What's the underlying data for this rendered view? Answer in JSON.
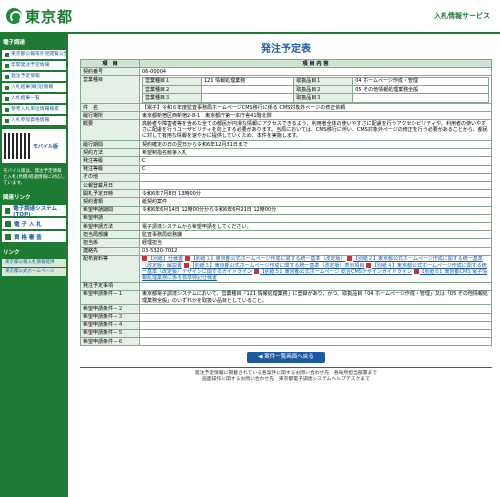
{
  "header": {
    "logo_text": "東京都",
    "right_link": "入札情報サービス"
  },
  "sidebar": {
    "section1": "電子調達",
    "items1": [
      "東京都公報等外見閲覧公告",
      "年間発注予定情報",
      "発注予定情報",
      "入札結果(概況)情報",
      "入札結果一覧",
      "参考入札単位情報検索",
      "入札参加資格情報"
    ],
    "mobile_title": "モバイル版",
    "mobile_note": "モバイル版は、発注予定情報と入札(見積)経過情報に対応しています。",
    "section2": "関連リンク",
    "items2_big": [
      "電子調達システム(TOP)",
      "電 子 入 札",
      "資 格 審 査"
    ],
    "section3": "リンク",
    "links": [
      "東京都公報入札情報提供",
      "東京都公式ホームページ"
    ]
  },
  "main": {
    "title": "発注予定表",
    "col_item": "項　目",
    "col_content": "項 目 内 容",
    "rows": [
      {
        "label": "契約番号",
        "value": "06-00004"
      },
      {
        "label": "営業種目",
        "nested": [
          [
            "営業種目１",
            "121 情報処理業務",
            "取扱品目１",
            "04 ホームページ作成・管理"
          ],
          [
            "営業種目２",
            "",
            "取扱品目２",
            "05 その他情報処理業務全般"
          ],
          [
            "営業種目３",
            "",
            "取扱品目３",
            ""
          ]
        ]
      },
      {
        "label": "件　名",
        "value": "【電子】令和６年度監査事務局ホームページCMS移行に係る CMS対象外ページの修正依頼"
      },
      {
        "label": "履行場所",
        "value": "東京都新宿区西新宿2-8-1　東京都庁第一本庁舎41階北側"
      },
      {
        "label": "概要",
        "value": "高齢者や障害者等を含めた全ての都民が円滑な情報にアクセスできるよう、利用者全体の使いやすさに配慮を行うアクセシビリティや、利用者の使いやすさに配慮を行うユーザビリティを向上する必要があります。当局においては、CMS移行に伴い、CMS対象外ページの修正を行う必要があることから、都民に対して有用な情報を速やかに提供していくため、本件を実施します。"
      },
      {
        "label": "履行期間",
        "value": "契約確定の日の翌日から令和6年12月31日まで"
      },
      {
        "label": "契約方法",
        "value": "希望制指名競争入札"
      },
      {
        "label": "発注等級",
        "value": "C"
      },
      {
        "label": "発注等級",
        "value": "C"
      },
      {
        "label": "その他",
        "value": ""
      },
      {
        "label": "公報登載月日",
        "value": ""
      },
      {
        "label": "開札予定日時",
        "value": "令和6年7月8日 13時00分"
      },
      {
        "label": "契約書類",
        "value": "紙契約案件"
      },
      {
        "label": "希望申請期間",
        "value": "令和6年6月14日 12時00分から令和6年6月21日 12時00分"
      },
      {
        "label": "希望申請",
        "value": ""
      },
      {
        "label": "希望申請方法",
        "value": "電子調達システムから希望申請をしてください。"
      },
      {
        "label": "担当局部課",
        "value": "監査事務局総務課"
      },
      {
        "label": "担当係",
        "value": "経理担当"
      },
      {
        "label": "連絡先",
        "value": "03-5320-7012"
      },
      {
        "label": "配布資料等",
        "docs": [
          "【別紙】仕様書",
          "【別紙１】東京都公式ホームページ作成に関する統一基準（改定版）",
          "【別紙２】東京都公式ホームページ作成に関する統一基準（改定版）解説書",
          "【別紙３】東京都公式ホームページ作成に関する統一基準（改定版）表示項目",
          "【別紙４】東京都公式ホームページ作成に関する統一基準（改定版）デザインに関するガイドライン",
          "【別紙５】東京都公式ホームページ 総合CMSデザインガイドライン",
          "【別紙６】東京都CMS 電子情報処理業務に係る標準特記仕様書"
        ]
      },
      {
        "label": "発注予定事項",
        "value": ""
      },
      {
        "label": "希望申請条件－１",
        "value": "東京都電子調達システムにおいて、営業種目「121 情報処理業務」に登録があり、かつ、取扱品目「04 ホームページ作成・管理」又は「05 その他情報処理業務全般」のいずれかを取扱い品目としていること。"
      },
      {
        "label": "希望申請条件－２",
        "value": ""
      },
      {
        "label": "希望申請条件－３",
        "value": ""
      },
      {
        "label": "希望申請条件－４",
        "value": ""
      },
      {
        "label": "希望申請条件－５",
        "value": ""
      },
      {
        "label": "希望申請条件－６",
        "value": ""
      }
    ],
    "list_button": "◀ 案件一覧画面へ戻る"
  },
  "footer": {
    "line1": "発注予定情報に掲載されている各案件に関するお問い合わせ先　各局所担当部署まで",
    "line2": "画面操作に関するお問い合わせ先　東京都電子調達システムヘルプデスクまで"
  },
  "colors": {
    "green": "#1e7b34",
    "blue": "#1e5aa0"
  }
}
